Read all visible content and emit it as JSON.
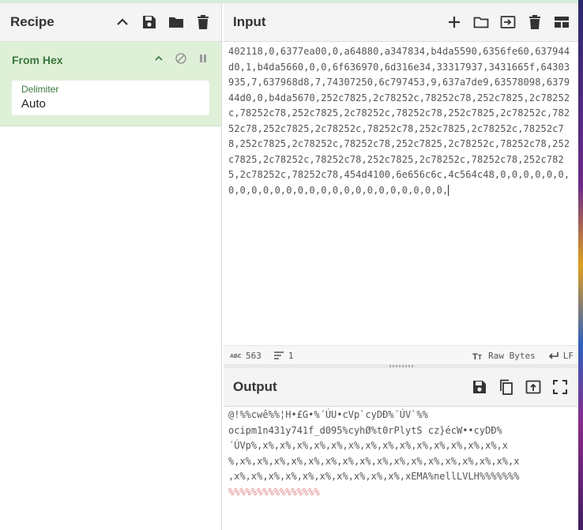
{
  "recipe": {
    "title": "Recipe",
    "operation": {
      "name": "From Hex",
      "arg_label": "Delimiter",
      "arg_value": "Auto"
    }
  },
  "input": {
    "title": "Input",
    "text": "402118,0,6377ea00,0,a64880,a347834,b4da5590,6356fe60,637944d0,1,b4da5660,0,0,6f636970,6d316e34,33317937,3431665f,64303935,7,637968d8,7,74307250,6c797453,9,637a7de9,63578098,637944d0,0,b4da5670,252c7825,2c78252c,78252c78,252c7825,2c78252c,78252c78,252c7825,2c78252c,78252c78,252c7825,2c78252c,78252c78,252c7825,2c78252c,78252c78,252c7825,2c78252c,78252c78,252c7825,2c78252c,78252c78,252c7825,2c78252c,78252c78,252c7825,2c78252c,78252c78,252c7825,2c78252c,78252c78,252c7825,2c78252c,78252c78,454d4100,6e656c6c,4c564c48,0,0,0,0,0,0,0,0,0,0,0,0,0,0,0,0,0,0,0,0,0,0,0,0,0,",
    "status": {
      "length": "563",
      "lines": "1",
      "format": "Raw Bytes",
      "eol": "LF"
    }
  },
  "output": {
    "title": "Output",
    "lines": [
      "@!%%cwê%%¦H•£G•%´ÚU•cVp`cyDÐ%´ÚV`%%",
      "ocipm1n431y741f_d095%cyhØ%t0rPlytS  cz}écW••cyDÐ%",
      "´ÚVp%,x%,x%,x%,x%,x%,x%,x%,x%,x%,x%,x%,x%,x%,x%,x",
      "%,x%,x%,x%,x%,x%,x%,x%,x%,x%,x%,x%,x%,x%,x%,x%,x%,x",
      ",x%,x%,x%,x%,x%,x%,x%,x%,x%,x%,xEMA%nellLVLH%%%%%%%",
      "%%%%%%%%%%%%%%%%"
    ]
  },
  "icons": {
    "collapse": "chevron-up-icon",
    "save": "save-icon",
    "folder": "folder-icon",
    "trash": "trash-icon",
    "plus": "plus-icon",
    "disable": "disable-icon",
    "pause": "pause-icon",
    "copy": "copy-icon",
    "replace_input": "replace-input-icon",
    "maximise": "maximise-icon",
    "layout": "layout-icon"
  },
  "colors": {
    "op_bg": "#dff0d8",
    "op_text": "#3c763d"
  }
}
